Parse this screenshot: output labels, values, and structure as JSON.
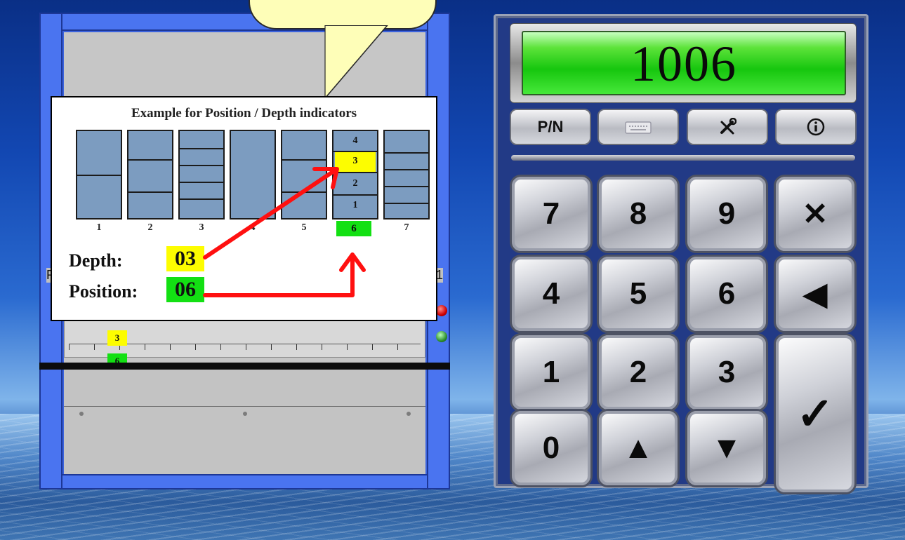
{
  "machine": {
    "side_left": "R",
    "side_right": "1",
    "tray_depth": "3",
    "tray_position": "6"
  },
  "example": {
    "title": "Example for Position / Depth indicators",
    "shelves": [
      "1",
      "2",
      "3",
      "4",
      "5",
      "6",
      "7"
    ],
    "highlight_shelf_cells": [
      "4",
      "3",
      "2",
      "1"
    ],
    "highlight_position": "6",
    "depth_label": "Depth:",
    "depth_value": "03",
    "position_label": "Position:",
    "position_value": "06",
    "colors": {
      "depth": "#fdfd00",
      "position": "#13e013",
      "arrow": "#ff0000"
    }
  },
  "keypad": {
    "display_value": "1006",
    "function_keys": {
      "pn": "P/N",
      "keyboard": "keyboard-icon",
      "tools": "tools-icon",
      "info": "info-icon"
    },
    "keys": {
      "k7": "7",
      "k8": "8",
      "k9": "9",
      "clear": "✕",
      "k4": "4",
      "k5": "5",
      "k6": "6",
      "back": "◀",
      "k1": "1",
      "k2": "2",
      "k3": "3",
      "enter": "✓",
      "k0": "0",
      "up": "▲",
      "down": "▼"
    }
  }
}
